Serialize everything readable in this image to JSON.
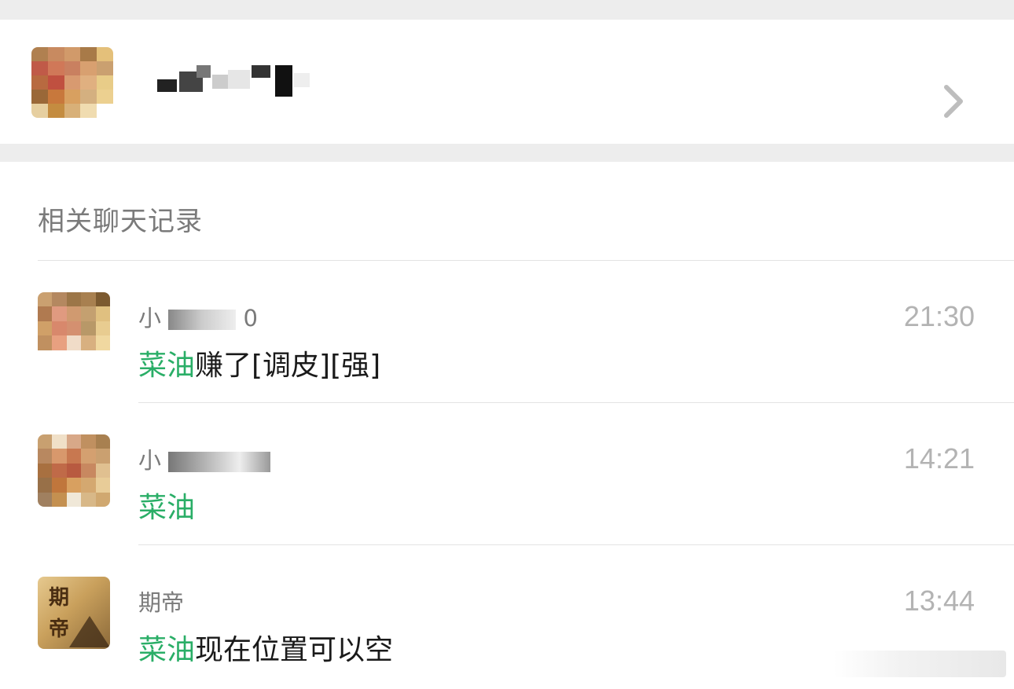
{
  "profile": {
    "name_redacted": true,
    "avatar_icon": "pixelated-avatar-icon",
    "chevron_icon": "chevron-right-icon"
  },
  "section": {
    "title": "相关聊天记录"
  },
  "results": [
    {
      "sender_visible": "小",
      "sender_suffix": "0",
      "time": "21:30",
      "keyword": "菜油",
      "rest": "赚了[调皮][强]"
    },
    {
      "sender_visible": "小",
      "sender_suffix": "",
      "time": "14:21",
      "keyword": "菜油",
      "rest": ""
    },
    {
      "sender_visible": "期帝",
      "sender_suffix": "",
      "time": "13:44",
      "keyword": "菜油",
      "rest": "现在位置可以空"
    }
  ],
  "avatar3": {
    "char1": "期",
    "char2": "帝"
  },
  "colors": {
    "keyword": "#2aae67",
    "time": "#b3b3b3",
    "background": "#ededed"
  }
}
